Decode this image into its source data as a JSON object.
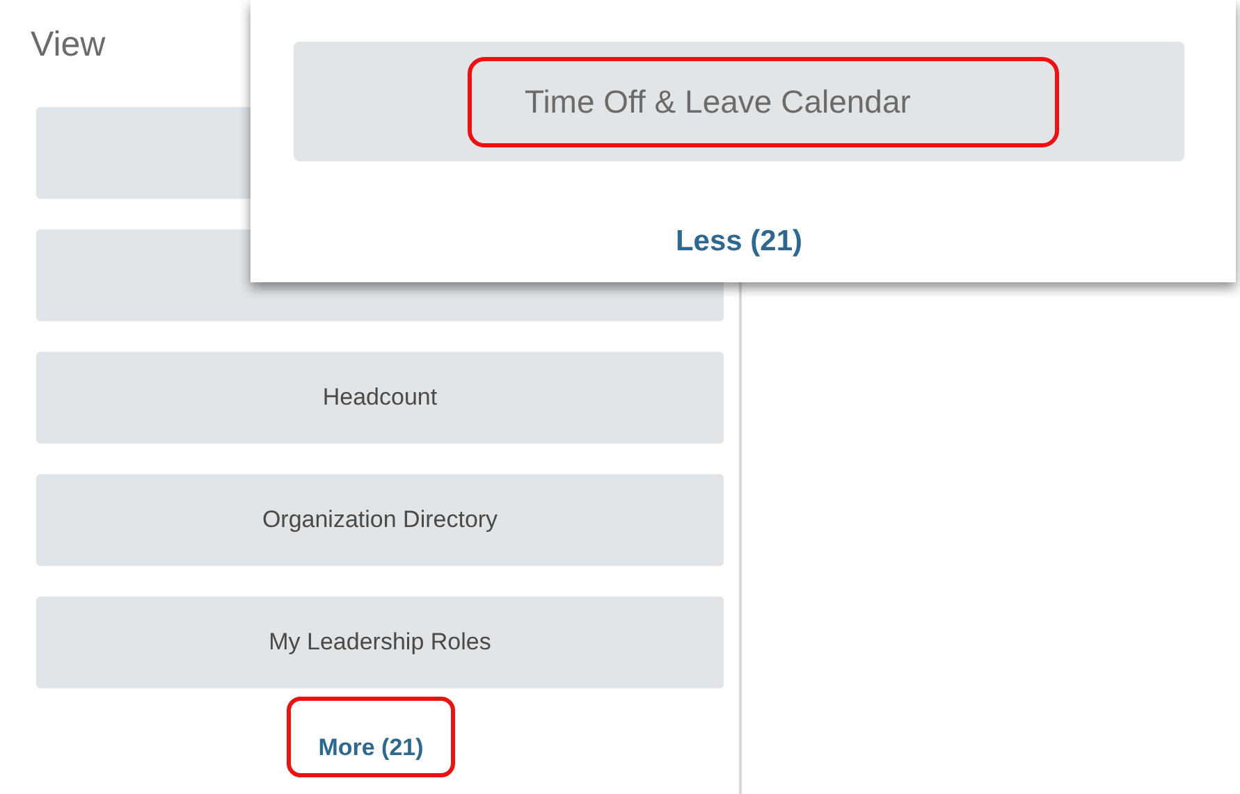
{
  "panel": {
    "title": "View",
    "buttons": [
      {
        "kind": "covered"
      },
      {
        "kind": "covered"
      },
      {
        "kind": "labeled",
        "label": "Headcount"
      },
      {
        "kind": "labeled",
        "label": "Organization Directory"
      },
      {
        "kind": "labeled",
        "label": "My Leadership Roles"
      }
    ],
    "more_link": {
      "label": "More (21)",
      "highlighted": true
    }
  },
  "popup": {
    "buttons": [
      {
        "label": "Time Off & Leave Calendar",
        "highlighted": true
      }
    ],
    "less_link": {
      "label": "Less (21)",
      "highlighted": false
    }
  }
}
